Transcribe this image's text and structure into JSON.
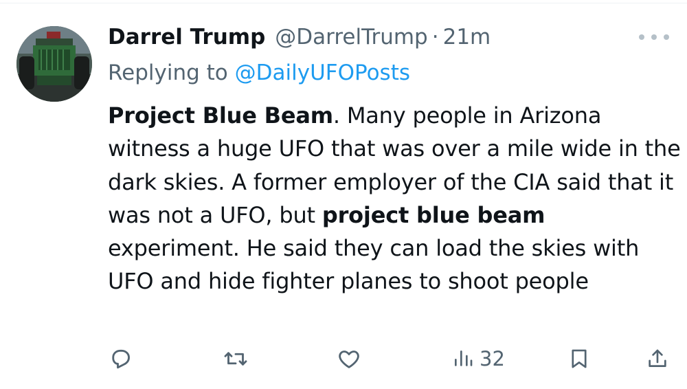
{
  "colors": {
    "text_primary": "#0f1419",
    "text_secondary": "#536471",
    "link": "#1d9bf0",
    "icon": "#536471"
  },
  "tweet": {
    "author": {
      "display_name": "Darrel Trump",
      "handle": "@DarrelTrump",
      "avatar_icon": "green-tractor-avatar"
    },
    "separator": "·",
    "timestamp": "21m",
    "replying_prefix": "Replying to ",
    "replying_to": "@DailyUFOPosts",
    "body": {
      "seg1_bold": "Project Blue Beam",
      "seg2": ".  Many people in Arizona witness a huge UFO that was over a mile wide in the dark skies.  A former employer of the CIA said that it was not a UFO, but ",
      "seg3_bold": "project blue beam",
      "seg4": " experiment.  He said they can load the skies with UFO and hide fighter planes to shoot people"
    },
    "more_icon": "more-horizontal-icon",
    "actions": {
      "reply_icon": "reply-icon",
      "retweet_icon": "retweet-icon",
      "like_icon": "heart-icon",
      "views_icon": "views-bar-chart-icon",
      "views_count": "32",
      "bookmark_icon": "bookmark-icon",
      "share_icon": "share-icon"
    }
  }
}
